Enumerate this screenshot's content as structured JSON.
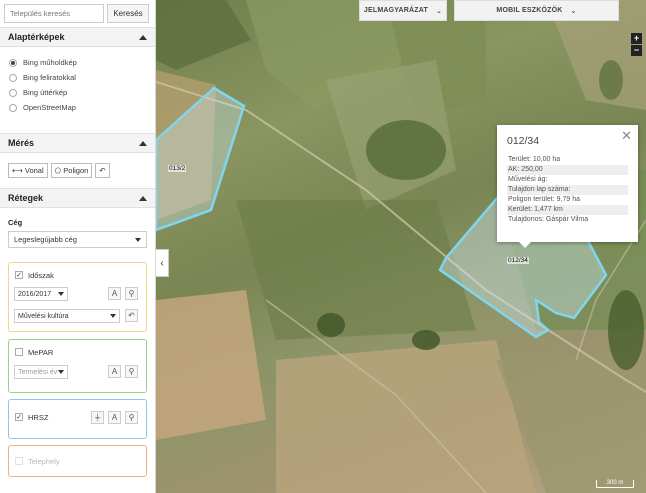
{
  "search": {
    "placeholder": "Település keresés",
    "button_label": "Keresés"
  },
  "basemaps": {
    "title": "Alaptérképek",
    "options": [
      {
        "label": "Bing műholdkép",
        "checked": true
      },
      {
        "label": "Bing feliratokkal",
        "checked": false
      },
      {
        "label": "Bing úttérkép",
        "checked": false
      },
      {
        "label": "OpenStreetMap",
        "checked": false
      }
    ]
  },
  "measure": {
    "title": "Mérés",
    "line_label": "Vonal",
    "polygon_label": "Poligon"
  },
  "layers": {
    "title": "Rétegek",
    "company_label": "Cég",
    "company_value": "Legeslegújabb cég",
    "idoszak": {
      "label": "Időszak",
      "checked": true,
      "year": "2016/2017",
      "culture": "Művelési kultúra",
      "border_color": "#f0d58a"
    },
    "mepar": {
      "label": "MePAR",
      "checked": false,
      "placeholder": "Termelési év",
      "border_color": "#9ad08a"
    },
    "hrsz": {
      "label": "HRSZ",
      "checked": true,
      "border_color": "#8ac8e8"
    },
    "telephely": {
      "label": "Telephely",
      "checked": false,
      "border_color": "#f0b07a"
    }
  },
  "map": {
    "legend_button": "JELMAGYARÁZAT",
    "mobile_button": "MOBIL ESZKÖZÖK",
    "zoom_in": "+",
    "zoom_out": "−",
    "parcel_left_label": "013/2",
    "parcel_right_label": "012/34",
    "scale_label": "300 m",
    "highlight_color": "#7fd6f0"
  },
  "popup": {
    "title": "012/34",
    "rows": [
      "Terület: 10,00 ha",
      "AK: 250,00",
      "Művelési ág:",
      "Tulajdon lap száma:",
      "Poligon terület: 9,79 ha",
      "Kerület: 1,477 km",
      "Tulajdonos: Gáspár Vilma"
    ]
  }
}
